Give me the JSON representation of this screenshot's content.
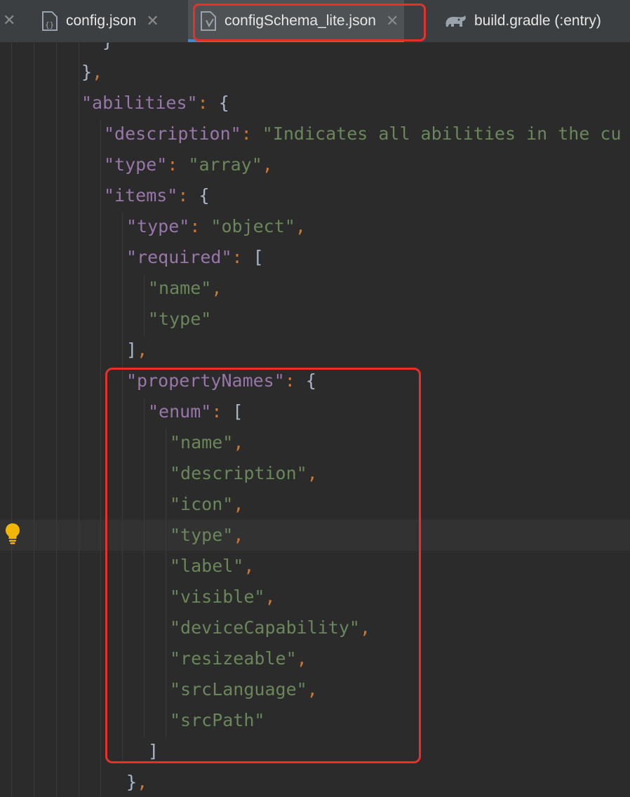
{
  "tabs": [
    {
      "label": "config.json",
      "icon": "json-file-icon",
      "active": false
    },
    {
      "label": "configSchema_lite.json",
      "icon": "json-file-icon",
      "active": true
    },
    {
      "label": "build.gradle (:entry)",
      "icon": "gradle-elephant-icon",
      "active": false
    }
  ],
  "editor": {
    "lines": [
      {
        "tokens": [
          {
            "t": "}",
            "c": "brk"
          }
        ]
      },
      {
        "tokens": [
          {
            "t": "}",
            "c": "brk"
          },
          {
            "t": ",",
            "c": "pun"
          }
        ]
      },
      {
        "tokens": [
          {
            "t": "\"abilities\"",
            "c": "key"
          },
          {
            "t": ": ",
            "c": "pun"
          },
          {
            "t": "{",
            "c": "brk"
          }
        ]
      },
      {
        "tokens": [
          {
            "t": "\"description\"",
            "c": "key"
          },
          {
            "t": ": ",
            "c": "pun"
          },
          {
            "t": "\"Indicates all abilities in the cu",
            "c": "str"
          }
        ]
      },
      {
        "tokens": [
          {
            "t": "\"type\"",
            "c": "key"
          },
          {
            "t": ": ",
            "c": "pun"
          },
          {
            "t": "\"array\"",
            "c": "str"
          },
          {
            "t": ",",
            "c": "pun"
          }
        ]
      },
      {
        "tokens": [
          {
            "t": "\"items\"",
            "c": "key"
          },
          {
            "t": ": ",
            "c": "pun"
          },
          {
            "t": "{",
            "c": "brk"
          }
        ]
      },
      {
        "tokens": [
          {
            "t": "\"type\"",
            "c": "key"
          },
          {
            "t": ": ",
            "c": "pun"
          },
          {
            "t": "\"object\"",
            "c": "str"
          },
          {
            "t": ",",
            "c": "pun"
          }
        ]
      },
      {
        "tokens": [
          {
            "t": "\"required\"",
            "c": "key"
          },
          {
            "t": ": ",
            "c": "pun"
          },
          {
            "t": "[",
            "c": "brk"
          }
        ]
      },
      {
        "tokens": [
          {
            "t": "\"name\"",
            "c": "str"
          },
          {
            "t": ",",
            "c": "pun"
          }
        ]
      },
      {
        "tokens": [
          {
            "t": "\"type\"",
            "c": "str"
          }
        ]
      },
      {
        "tokens": [
          {
            "t": "]",
            "c": "brk"
          },
          {
            "t": ",",
            "c": "pun"
          }
        ]
      },
      {
        "tokens": [
          {
            "t": "\"propertyNames\"",
            "c": "key"
          },
          {
            "t": ": ",
            "c": "pun"
          },
          {
            "t": "{",
            "c": "brk"
          }
        ]
      },
      {
        "tokens": [
          {
            "t": "\"enum\"",
            "c": "key"
          },
          {
            "t": ": ",
            "c": "pun"
          },
          {
            "t": "[",
            "c": "brk"
          }
        ]
      },
      {
        "tokens": [
          {
            "t": "\"name\"",
            "c": "str"
          },
          {
            "t": ",",
            "c": "pun"
          }
        ]
      },
      {
        "tokens": [
          {
            "t": "\"description\"",
            "c": "str"
          },
          {
            "t": ",",
            "c": "pun"
          }
        ]
      },
      {
        "tokens": [
          {
            "t": "\"icon\"",
            "c": "str"
          },
          {
            "t": ",",
            "c": "pun"
          }
        ]
      },
      {
        "tokens": [
          {
            "t": "\"type\"",
            "c": "str"
          },
          {
            "t": ",",
            "c": "pun"
          }
        ]
      },
      {
        "tokens": [
          {
            "t": "\"label\"",
            "c": "str"
          },
          {
            "t": ",",
            "c": "pun"
          }
        ]
      },
      {
        "tokens": [
          {
            "t": "\"visible\"",
            "c": "str"
          },
          {
            "t": ",",
            "c": "pun"
          }
        ]
      },
      {
        "tokens": [
          {
            "t": "\"deviceCapability\"",
            "c": "str"
          },
          {
            "t": ",",
            "c": "pun"
          }
        ]
      },
      {
        "tokens": [
          {
            "t": "\"resizeable\"",
            "c": "str"
          },
          {
            "t": ",",
            "c": "pun"
          }
        ]
      },
      {
        "tokens": [
          {
            "t": "\"srcLanguage\"",
            "c": "str"
          },
          {
            "t": ",",
            "c": "pun"
          }
        ]
      },
      {
        "tokens": [
          {
            "t": "\"srcPath\"",
            "c": "str"
          }
        ]
      },
      {
        "tokens": [
          {
            "t": "]",
            "c": "brk"
          }
        ]
      },
      {
        "tokens": [
          {
            "t": "}",
            "c": "brk"
          },
          {
            "t": ",",
            "c": "pun"
          }
        ]
      }
    ],
    "gutter_icon": "intention-bulb-icon"
  },
  "colors": {
    "key": "#9876aa",
    "string": "#6a8759",
    "punctuation": "#cc7832",
    "bracket": "#a9b7c6",
    "highlight_box": "#e8302b",
    "active_tab_underline": "#4a88c7"
  }
}
